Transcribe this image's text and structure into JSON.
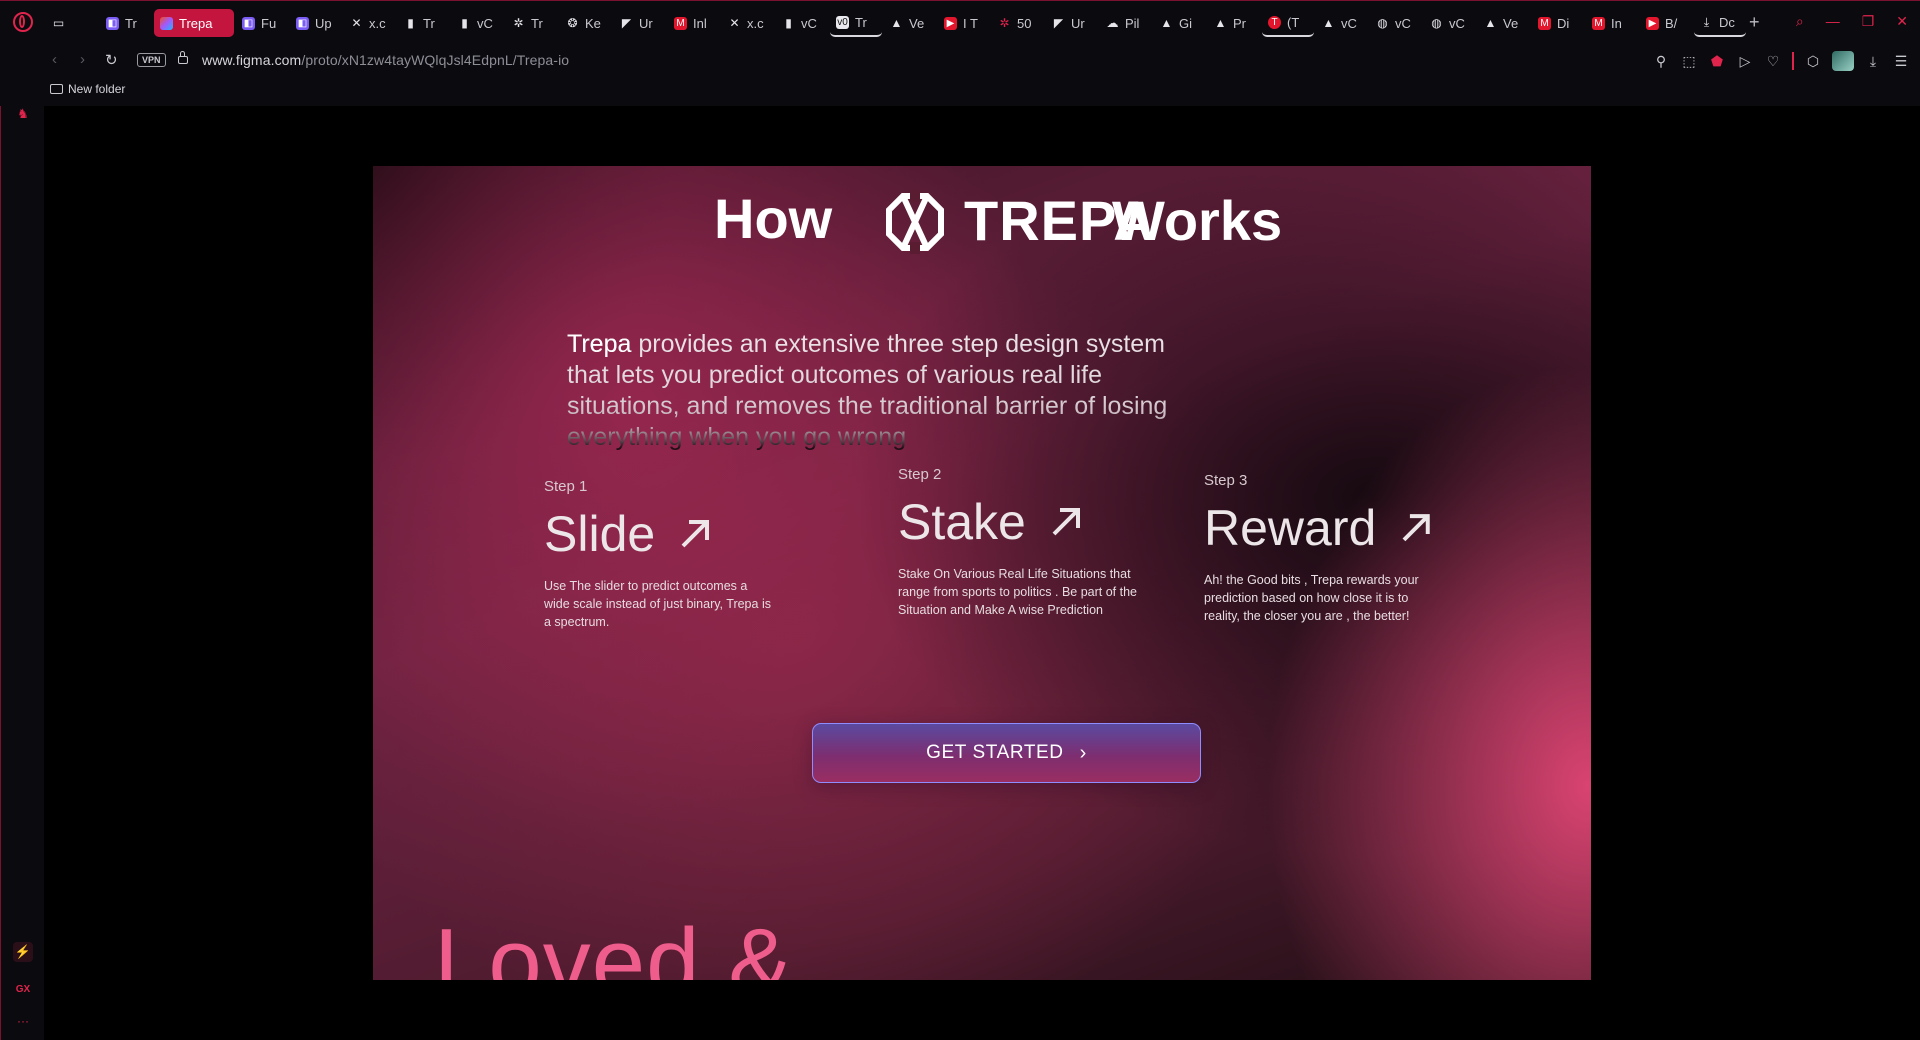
{
  "browser": {
    "tabs": [
      {
        "label": "Tr",
        "icon": "purple-tile-icon"
      },
      {
        "label": "Trepa",
        "icon": "figma-icon",
        "active": true
      },
      {
        "label": "Fu",
        "icon": "purple-tile-icon"
      },
      {
        "label": "Up",
        "icon": "purple-tile-icon"
      },
      {
        "label": "x.c",
        "icon": "x-logo-icon"
      },
      {
        "label": "Tr",
        "icon": "document-icon"
      },
      {
        "label": "vC",
        "icon": "document-icon"
      },
      {
        "label": "Tr",
        "icon": "asterisk-icon"
      },
      {
        "label": "Ke",
        "icon": "chatgpt-icon"
      },
      {
        "label": "Ur",
        "icon": "framer-icon"
      },
      {
        "label": "Inl",
        "icon": "gmail-icon"
      },
      {
        "label": "x.c",
        "icon": "x-logo-icon"
      },
      {
        "label": "vC",
        "icon": "document-icon"
      },
      {
        "label": "Tr",
        "icon": "vo-icon",
        "underlined": true
      },
      {
        "label": "Ve",
        "icon": "triangle-icon"
      },
      {
        "label": "I T",
        "icon": "youtube-icon"
      },
      {
        "label": "50",
        "icon": "asterisk-icon"
      },
      {
        "label": "Ur",
        "icon": "framer-icon"
      },
      {
        "label": "Pil",
        "icon": "cloud-icon"
      },
      {
        "label": "Gi",
        "icon": "triangle-icon"
      },
      {
        "label": "Pr",
        "icon": "triangle-icon"
      },
      {
        "label": "(T",
        "icon": "trepa-icon",
        "underlined": true
      },
      {
        "label": "vC",
        "icon": "triangle-icon"
      },
      {
        "label": "vC",
        "icon": "globe-icon"
      },
      {
        "label": "vC",
        "icon": "globe-icon"
      },
      {
        "label": "Ve",
        "icon": "triangle-icon"
      },
      {
        "label": "Di",
        "icon": "gmail-icon"
      },
      {
        "label": "In",
        "icon": "gmail-icon"
      },
      {
        "label": "B/",
        "icon": "youtube-icon"
      },
      {
        "label": "Dc",
        "icon": "download-icon",
        "underlined": true
      }
    ],
    "new_tab": "+",
    "address": {
      "vpn": "VPN",
      "url_host": "www.figma.com",
      "url_path": "/proto/xN1zw4tayWQlqJsl4EdpnL/Trepa-io"
    },
    "bookmarks": [
      {
        "label": "New folder"
      }
    ],
    "sidebar_bottom": {
      "gx": "GX",
      "more": "···"
    }
  },
  "page": {
    "title_left": "How",
    "brand": "TREPA",
    "title_right": "Works",
    "intro_brand": "Trepa",
    "intro_rest": " provides an extensive three step design system that lets you predict outcomes of various real life situations, and removes the traditional barrier of losing everything when you go wrong",
    "steps": [
      {
        "label": "Step 1",
        "title": "Slide",
        "description": "Use The slider to predict outcomes a wide scale instead of just binary, Trepa is a spectrum."
      },
      {
        "label": "Step 2",
        "title": "Stake",
        "description": "Stake On Various Real Life Situations that range from sports to politics . Be part of the Situation and Make A wise Prediction"
      },
      {
        "label": "Step 3",
        "title": "Reward",
        "description": "Ah! the Good bits , Trepa rewards your prediction based on how close it is to reality, the closer you are , the better!"
      }
    ],
    "cta_label": "GET STARTED",
    "cta_icon": "chevron-right-icon",
    "next_section_heading": "Loved &"
  },
  "colors": {
    "browser_accent": "#e0244c",
    "active_tab": "#c4153e",
    "cta_border": "#8f8cff",
    "next_heading": "#ef5d8c"
  }
}
